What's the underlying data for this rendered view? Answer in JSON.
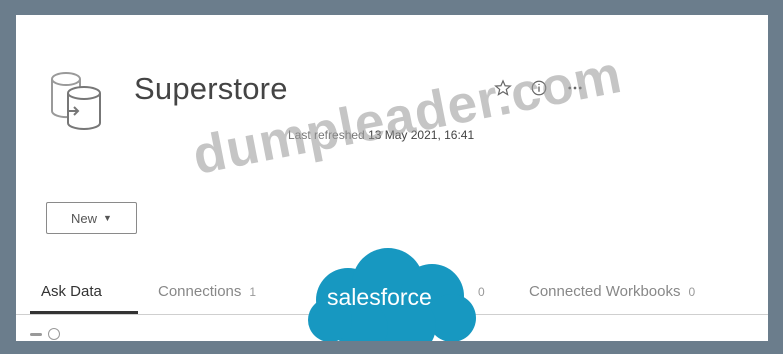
{
  "header": {
    "title": "Superstore",
    "refresh_label": "Last refreshed",
    "refresh_date": "13 May 2021, 16:41"
  },
  "toolbar": {
    "favorite_icon": "star-icon",
    "info_icon": "info-icon",
    "more_icon": "more-icon",
    "new_label": "New"
  },
  "tabs": [
    {
      "label": "Ask Data",
      "count": "",
      "active": true
    },
    {
      "label": "Connections",
      "count": "1",
      "active": false
    },
    {
      "label": "",
      "count": "0",
      "active": false
    },
    {
      "label": "Connected Workbooks",
      "count": "0",
      "active": false
    }
  ],
  "overlays": {
    "watermark": "dumpleader.com",
    "brand": "salesforce",
    "brand_color": "#1798c1"
  },
  "colors": {
    "frame": "#6b7d8c",
    "panel": "#ffffff",
    "text": "#444444"
  }
}
